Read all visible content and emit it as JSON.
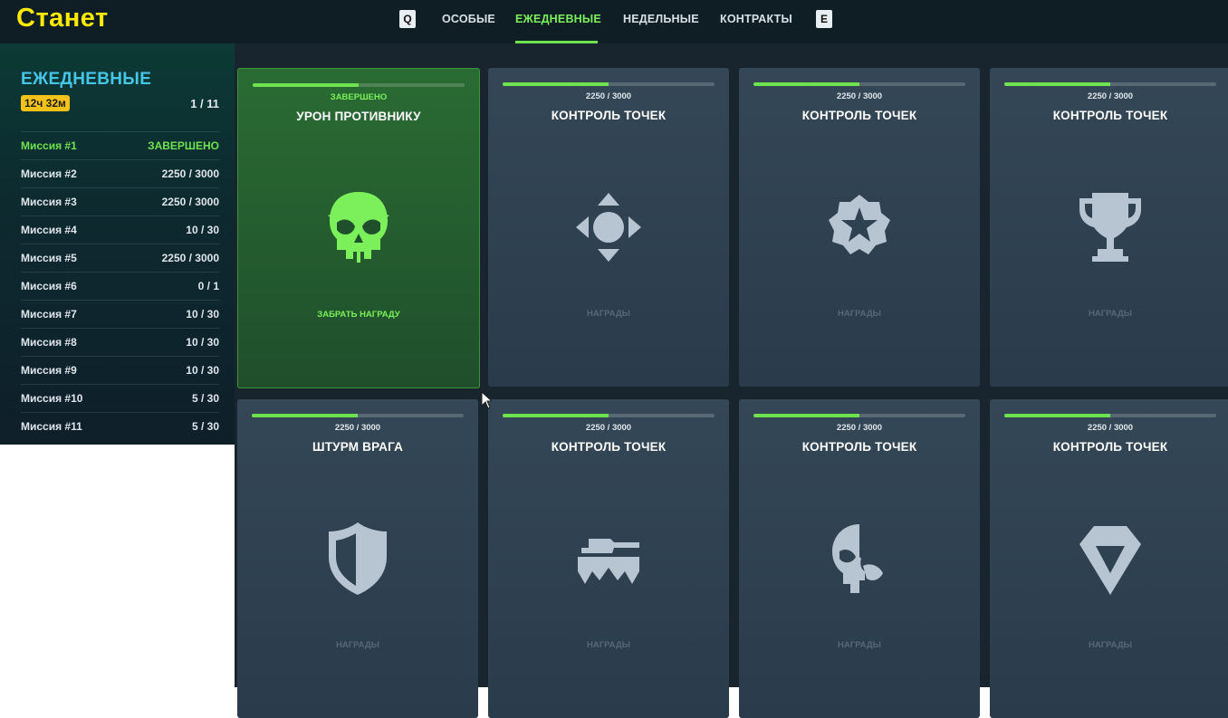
{
  "overlay_caption": "Станет",
  "nav": {
    "key_left": "Q",
    "key_right": "E",
    "tabs": [
      {
        "label": "ОСОБЫЕ",
        "active": false
      },
      {
        "label": "ЕЖЕДНЕВНЫЕ",
        "active": true
      },
      {
        "label": "НЕДЕЛЬНЫЕ",
        "active": false
      },
      {
        "label": "КОНТРАКТЫ",
        "active": false
      }
    ]
  },
  "sidebar": {
    "title": "ЕЖЕДНЕВНЫЕ",
    "timer": "12ч 32м",
    "count": "1 / 11",
    "missions": [
      {
        "name": "Миссия #1",
        "value": "ЗАВЕРШЕНО",
        "done": true
      },
      {
        "name": "Миссия #2",
        "value": "2250 / 3000",
        "done": false
      },
      {
        "name": "Миссия #3",
        "value": "2250 / 3000",
        "done": false
      },
      {
        "name": "Миссия #4",
        "value": "10 / 30",
        "done": false
      },
      {
        "name": "Миссия #5",
        "value": "2250 / 3000",
        "done": false
      },
      {
        "name": "Миссия #6",
        "value": "0 / 1",
        "done": false
      },
      {
        "name": "Миссия #7",
        "value": "10 / 30",
        "done": false
      },
      {
        "name": "Миссия #8",
        "value": "10 / 30",
        "done": false
      },
      {
        "name": "Миссия #9",
        "value": "10 / 30",
        "done": false
      },
      {
        "name": "Миссия #10",
        "value": "5 / 30",
        "done": false
      },
      {
        "name": "Миссия #11",
        "value": "5 / 30",
        "done": false
      }
    ]
  },
  "cards": [
    {
      "progress_text": "ЗАВЕРШЕНО",
      "progress": 0.5,
      "title": "УРОН ПРОТИВНИКУ",
      "icon": "skull-icon",
      "footer": "ЗАБРАТЬ НАГРАДУ",
      "complete": true
    },
    {
      "progress_text": "2250 / 3000",
      "progress": 0.5,
      "title": "КОНТРОЛЬ ТОЧЕК",
      "icon": "dpad-icon",
      "footer": "НАГРАДЫ",
      "complete": false
    },
    {
      "progress_text": "2250 / 3000",
      "progress": 0.5,
      "title": "КОНТРОЛЬ ТОЧЕК",
      "icon": "star-badge-icon",
      "footer": "НАГРАДЫ",
      "complete": false
    },
    {
      "progress_text": "2250 / 3000",
      "progress": 0.5,
      "title": "КОНТРОЛЬ ТОЧЕК",
      "icon": "trophy-icon",
      "footer": "НАГРАДЫ",
      "complete": false
    },
    {
      "progress_text": "2250 / 3000",
      "progress": 0.5,
      "title": "ШТУРМ ВРАГА",
      "icon": "shield-icon",
      "footer": "НАГРАДЫ",
      "complete": false
    },
    {
      "progress_text": "2250 / 3000",
      "progress": 0.5,
      "title": "КОНТРОЛЬ ТОЧЕК",
      "icon": "tank-icon",
      "footer": "НАГРАДЫ",
      "complete": false
    },
    {
      "progress_text": "2250 / 3000",
      "progress": 0.5,
      "title": "КОНТРОЛЬ ТОЧЕК",
      "icon": "half-skull-icon",
      "footer": "НАГРАДЫ",
      "complete": false
    },
    {
      "progress_text": "2250 / 3000",
      "progress": 0.5,
      "title": "КОНТРОЛЬ ТОЧЕК",
      "icon": "diamond-icon",
      "footer": "НАГРАДЫ",
      "complete": false
    }
  ],
  "colors": {
    "accent_green": "#6fe24f",
    "title_cyan": "#45c6e6",
    "timer_yellow": "#f5c21a",
    "icon_gray": "#b7c4d2"
  }
}
